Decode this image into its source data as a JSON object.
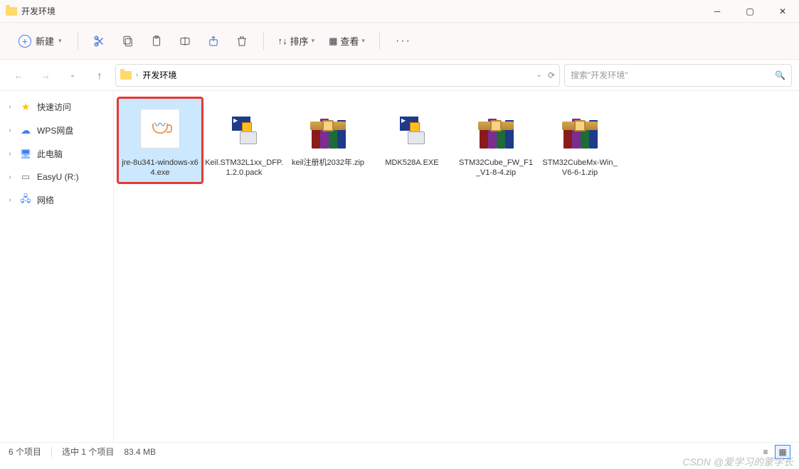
{
  "window": {
    "title": "开发环境"
  },
  "toolbar": {
    "new_label": "新建",
    "sort_label": "排序",
    "view_label": "查看"
  },
  "address": {
    "location": "开发环境"
  },
  "search": {
    "placeholder": "搜索\"开发环境\""
  },
  "sidebar": {
    "items": [
      {
        "label": "快速访问",
        "icon": "star"
      },
      {
        "label": "WPS网盘",
        "icon": "cloud"
      },
      {
        "label": "此电脑",
        "icon": "pc"
      },
      {
        "label": "EasyU (R:)",
        "icon": "disk"
      },
      {
        "label": "网络",
        "icon": "net"
      }
    ]
  },
  "files": [
    {
      "name": "jre-8u341-windows-x64.exe",
      "type": "java",
      "selected": true,
      "highlight": true
    },
    {
      "name": "Keil.STM32L1xx_DFP.1.2.0.pack",
      "type": "installer"
    },
    {
      "name": "keil注册机2032年.zip",
      "type": "rar"
    },
    {
      "name": "MDK528A.EXE",
      "type": "installer"
    },
    {
      "name": "STM32Cube_FW_F1_V1-8-4.zip",
      "type": "rar"
    },
    {
      "name": "STM32CubeMx-Win_V6-6-1.zip",
      "type": "rar"
    }
  ],
  "status": {
    "item_count": "6 个项目",
    "selection": "选中 1 个项目",
    "size": "83.4 MB"
  },
  "watermark": "CSDN @爱学习的蒙学长"
}
